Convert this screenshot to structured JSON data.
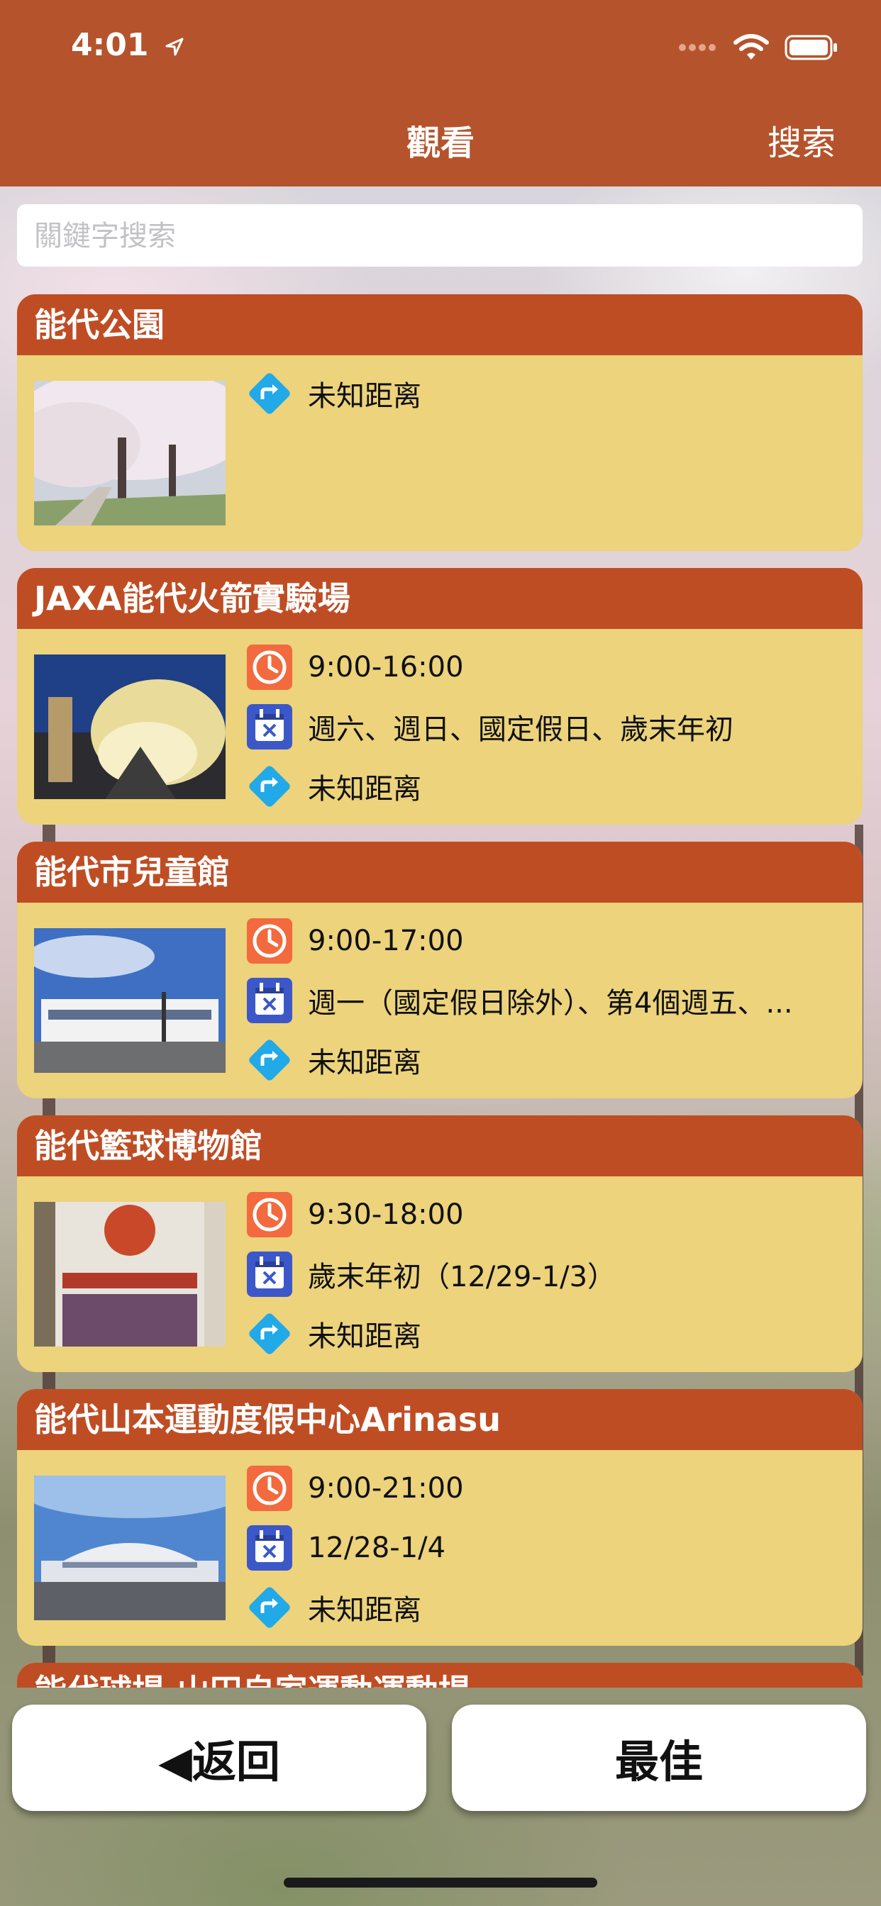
{
  "status": {
    "time": "4:01"
  },
  "nav": {
    "title": "觀看",
    "search": "搜索"
  },
  "search": {
    "placeholder": "關鍵字搜索",
    "value": ""
  },
  "items": [
    {
      "title": "能代公園",
      "distance": "未知距离"
    },
    {
      "title": "JAXA能代火箭實驗場",
      "hours": "9:00-16:00",
      "closed": "週六、週日、國定假日、歲末年初",
      "distance": "未知距离"
    },
    {
      "title": "能代市兒童館",
      "hours": "9:00-17:00",
      "closed": "週一（國定假日除外）、第4個週五、...",
      "distance": "未知距离"
    },
    {
      "title": "能代籃球博物館",
      "hours": "9:30-18:00",
      "closed": "歲末年初（12/29-1/3）",
      "distance": "未知距离"
    },
    {
      "title": "能代山本運動度假中心Arinasu",
      "hours": "9:00-21:00",
      "closed": "12/28-1/4",
      "distance": "未知距离"
    },
    {
      "title": "能代球場·山田自家運動運動場"
    }
  ],
  "footer": {
    "back": "◀返回",
    "best": "最佳"
  },
  "icons": {
    "clock": "clock-icon",
    "calendar": "calendar-closed-icon",
    "directions": "directions-icon"
  },
  "colors": {
    "bar": "#b5532c",
    "card_header": "#bf4d24",
    "card_body": "#ecd37c",
    "clock": "#f26a3d",
    "calendar": "#3c58c8",
    "directions": "#21a9e8"
  }
}
